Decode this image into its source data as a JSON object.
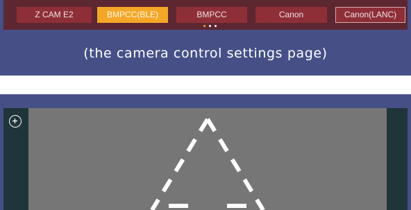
{
  "camera_bar": {
    "buttons": [
      {
        "label": "Z CAM E2",
        "active": false
      },
      {
        "label": "BMPCC(BLE)",
        "active": true
      },
      {
        "label": "BMPCC",
        "active": false
      },
      {
        "label": "Canon",
        "active": false
      },
      {
        "label": "Canon(LANC)",
        "active": false
      }
    ],
    "page_indicator": {
      "pages": 3,
      "current": 1
    }
  },
  "caption": "(the camera control settings page)",
  "preview": {
    "add_icon": "plus-circle-icon",
    "overlay_icon": "dashed-triangle"
  },
  "colors": {
    "panel": "#465087",
    "camera_bar": "#5d2731",
    "button": "#8e2f38",
    "button_active": "#f4a727",
    "preview_frame": "#1f3539",
    "preview_area": "#767676"
  }
}
